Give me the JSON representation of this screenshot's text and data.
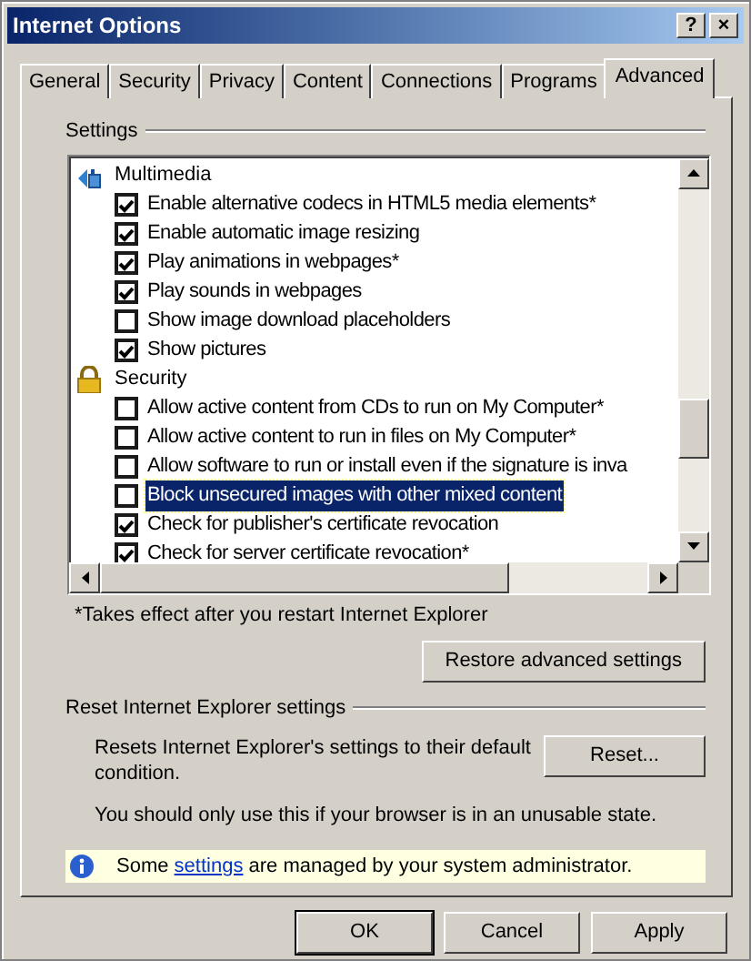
{
  "window": {
    "title": "Internet Options"
  },
  "title_buttons": [
    "?",
    "×"
  ],
  "tabs": [
    {
      "label": "General",
      "selected": false
    },
    {
      "label": "Security",
      "selected": false
    },
    {
      "label": "Privacy",
      "selected": false
    },
    {
      "label": "Content",
      "selected": false
    },
    {
      "label": "Connections",
      "selected": false
    },
    {
      "label": "Programs",
      "selected": false
    },
    {
      "label": "Advanced",
      "selected": true
    }
  ],
  "settings": {
    "label": "Settings",
    "items": [
      {
        "kind": "category",
        "label": "Multimedia"
      },
      {
        "kind": "checkbox",
        "label": "Enable alternative codecs in HTML5 media elements*",
        "checked": true,
        "selected": false
      },
      {
        "kind": "checkbox",
        "label": "Enable automatic image resizing",
        "checked": true,
        "selected": false
      },
      {
        "kind": "checkbox",
        "label": "Play animations in webpages*",
        "checked": true,
        "selected": false
      },
      {
        "kind": "checkbox",
        "label": "Play sounds in webpages",
        "checked": true,
        "selected": false
      },
      {
        "kind": "checkbox",
        "label": "Show image download placeholders",
        "checked": false,
        "selected": false
      },
      {
        "kind": "checkbox",
        "label": "Show pictures",
        "checked": true,
        "selected": false
      },
      {
        "kind": "category",
        "label": "Security"
      },
      {
        "kind": "checkbox",
        "label": "Allow active content from CDs to run on My Computer*",
        "checked": false,
        "selected": false
      },
      {
        "kind": "checkbox",
        "label": "Allow active content to run in files on My Computer*",
        "checked": false,
        "selected": false
      },
      {
        "kind": "checkbox",
        "label": "Allow software to run or install even if the signature is inva",
        "checked": false,
        "selected": false
      },
      {
        "kind": "checkbox",
        "label": "Block unsecured images with other mixed content",
        "checked": false,
        "selected": true
      },
      {
        "kind": "checkbox",
        "label": "Check for publisher's certificate revocation",
        "checked": true,
        "selected": false
      },
      {
        "kind": "checkbox",
        "label": "Check for server certificate revocation*",
        "checked": true,
        "selected": false
      }
    ],
    "note": "*Takes effect after you restart Internet Explorer",
    "restore_button": "Restore advanced settings"
  },
  "reset": {
    "label": "Reset Internet Explorer settings",
    "description": "Resets Internet Explorer's settings to their default condition.",
    "button": "Reset...",
    "warning": "You should only use this if your browser is in an unusable state."
  },
  "info_bar": {
    "before": "Some ",
    "link": "settings",
    "after": " are managed by your system administrator."
  },
  "buttons": [
    "OK",
    "Cancel",
    "Apply"
  ]
}
